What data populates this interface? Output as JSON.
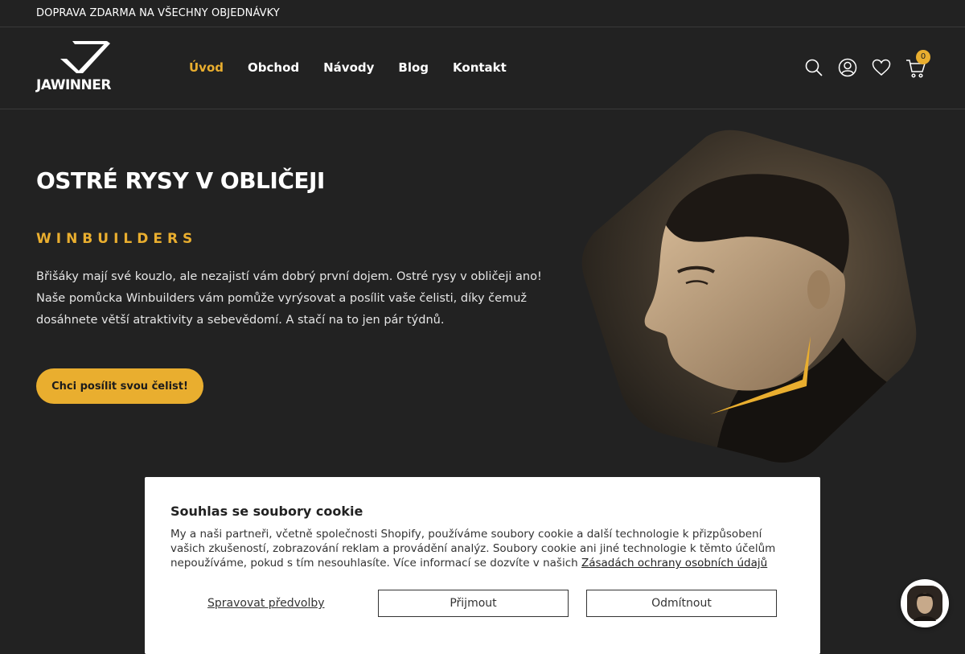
{
  "announcement": "DOPRAVA ZDARMA NA VŠECHNY OBJEDNÁVKY",
  "brand": {
    "logo_text": "JAWINNER"
  },
  "nav": {
    "items": [
      {
        "label": "Úvod",
        "active": true
      },
      {
        "label": "Obchod",
        "active": false
      },
      {
        "label": "Návody",
        "active": false
      },
      {
        "label": "Blog",
        "active": false
      },
      {
        "label": "Kontakt",
        "active": false
      }
    ]
  },
  "header_icons": {
    "search": "search-icon",
    "account": "user-icon",
    "wishlist": "heart-icon",
    "cart": "cart-icon",
    "cart_count": "0"
  },
  "hero": {
    "title": "OSTRÉ RYSY V OBLIČEJI",
    "subtitle": "WINBUILDERS",
    "description": "Břišáky mají své kouzlo, ale nezajistí vám dobrý první dojem. Ostré rysy v obličeji ano! Naše pomůcka Winbuilders vám pomůže vyrýsovat a posílit vaše čelisti, díky čemuž dosáhnete větší atraktivity a sebevědomí. A stačí na to jen pár týdnů.",
    "cta_label": "Chci posílit svou čelist!"
  },
  "cookie": {
    "title": "Souhlas se soubory cookie",
    "text": "My a naši partneři, včetně společnosti Shopify, používáme soubory cookie a další technologie k přizpůsobení vašich zkušeností, zobrazování reklam a provádění analýz. Soubory cookie ani jiné technologie k těmto účelům nepoužíváme, pokud s tím nesouhlasíte. Více informací se dozvíte v našich ",
    "privacy_link": "Zásadách ochrany osobních údajů",
    "manage_label": "Spravovat předvolby",
    "accept_label": "Přijmout",
    "decline_label": "Odmítnout"
  },
  "colors": {
    "background": "#222222",
    "accent": "#e9ae2f",
    "text": "#ffffff"
  }
}
